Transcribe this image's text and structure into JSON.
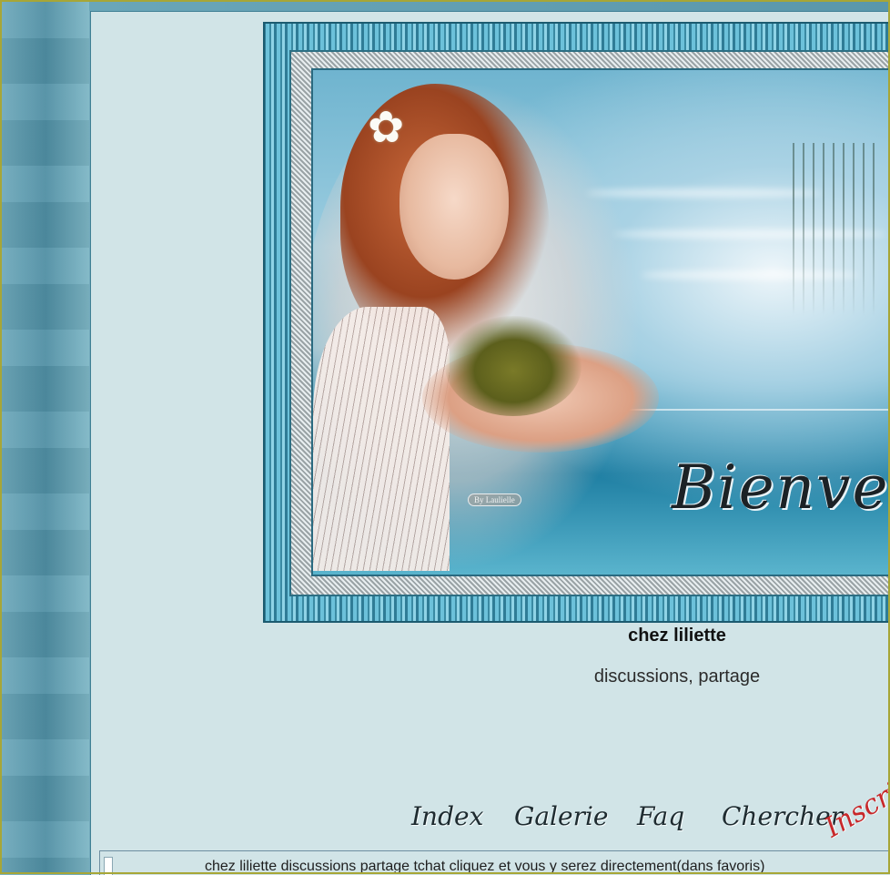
{
  "banner": {
    "welcome_text": "Bienvenu",
    "watermark": "By Laulielle",
    "image_desc": "woman-holding-tree"
  },
  "site": {
    "title": "chez liliette",
    "description": "discussions, partage"
  },
  "nav": {
    "items": [
      {
        "label": "Index"
      },
      {
        "label": "Galerie"
      },
      {
        "label": "Faq"
      },
      {
        "label": "Chercher"
      },
      {
        "label": "Inscri"
      }
    ]
  },
  "marquee": {
    "text": "chez liliette discussions partage tchat cliquez et vous y serez directement(dans favoris)"
  },
  "colors": {
    "frame": "#a7a637",
    "panel": "#d1e4e7",
    "accent_red": "#c8282a"
  }
}
